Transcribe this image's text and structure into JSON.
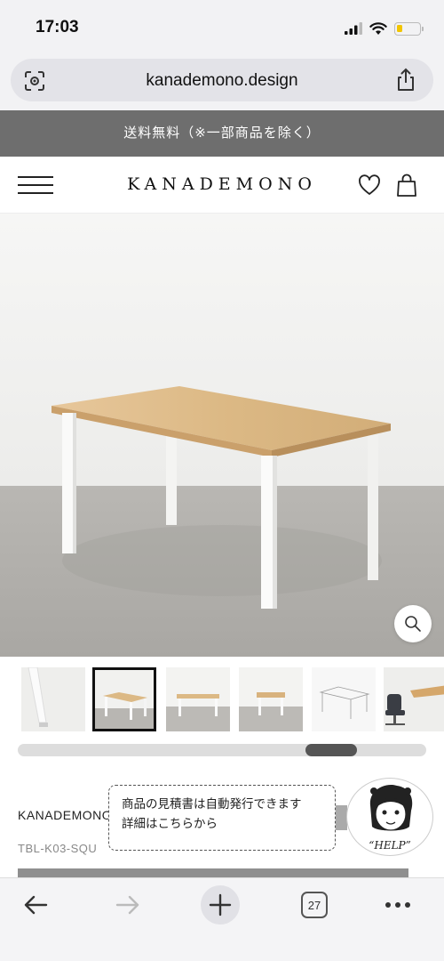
{
  "status_bar": {
    "time": "17:03",
    "battery_level": 0.2,
    "battery_color": "#f2c500"
  },
  "browser": {
    "domain": "kanademono.design",
    "tab_count": "27",
    "icons": [
      "lens-icon",
      "share-icon",
      "back-arrow-icon",
      "forward-arrow-icon",
      "new-tab-plus-icon",
      "tabs-icon",
      "more-icon"
    ]
  },
  "promo": {
    "text": "送料無料（※一部商品を除く）",
    "background": "#6e6e6e"
  },
  "header": {
    "logo": "KANADEMONO",
    "icons": [
      "hamburger-menu-icon",
      "heart-icon",
      "shopping-bag-icon"
    ]
  },
  "gallery": {
    "thumbnail_count": 6,
    "selected_thumbnail_index": 1,
    "scroll_position": 0.7
  },
  "product": {
    "brand": "KANADEMONO",
    "sku": "TBL-K03-SQU"
  },
  "help": {
    "line1": "商品の見積書は自動発行できます",
    "line2": "詳細はこちらから",
    "badge": "“HELP”"
  }
}
